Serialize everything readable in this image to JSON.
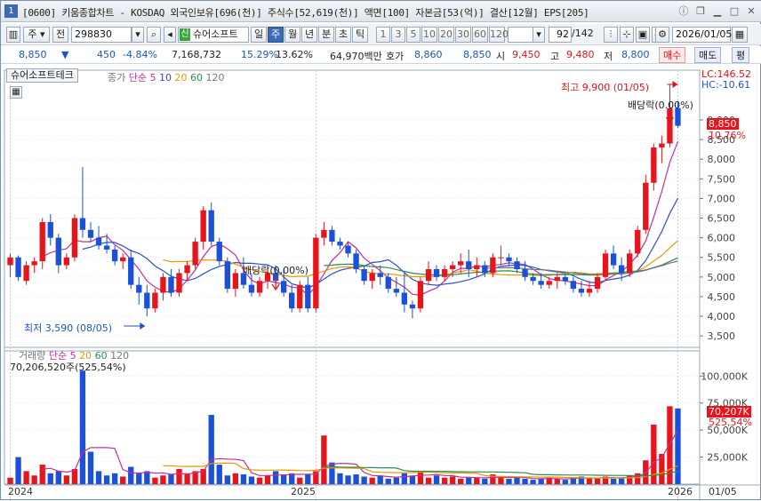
{
  "titlebar": {
    "num": "1",
    "title": "[0600] 키움종합차트 - KOSDAQ 외국인보유[696(천)] 주식수[52,619(천)] 액면[100] 자본금[53(억)] 결산[12월] EPS[205]"
  },
  "toolbar": {
    "period_select": "주",
    "prev_label": "전",
    "code": "298830",
    "name": "슈어소프트",
    "sin_label": "신",
    "periods": [
      "일",
      "주",
      "월",
      "년",
      "분",
      "초",
      "틱"
    ],
    "active_period": "주",
    "intervals": [
      "1",
      "3",
      "5",
      "10",
      "20",
      "30",
      "60",
      "120"
    ],
    "count": "92",
    "total": "/142",
    "date": "2026/01/05"
  },
  "quote": {
    "price": "8,850",
    "change": "450",
    "change_pct": "-4.84%",
    "volume": "7,168,732",
    "ratio1": "15.29%",
    "ratio2": "13.62%",
    "amount": "64,970백만",
    "ask_label": "호가",
    "ask1": "8,860",
    "ask2": "8,850",
    "open_label": "시",
    "open": "9,450",
    "high_label": "고",
    "high": "9,480",
    "low_label": "저",
    "low": "8,800",
    "buy_label": "매수",
    "sell_label": "매도",
    "avg_label": "평"
  },
  "chart": {
    "tab_name": "슈어소프트테크",
    "price_legend": {
      "title": "종가",
      "kind": "단순",
      "ma": [
        "5",
        "10",
        "20",
        "60",
        "120"
      ]
    },
    "vol_legend": {
      "title": "거래량",
      "kind": "단순",
      "ma": [
        "5",
        "20",
        "60",
        "120"
      ]
    },
    "vol_value": "70,206,520주(525,54%)",
    "lc": "LC:146.52",
    "hc": "HC:-10.61",
    "high_note": "최고 9,900 (01/05)",
    "low_note": "최저 3,590 (08/05)",
    "div1": "배당락(0.00%)",
    "div2": "배당락(0,00%)",
    "last_price_tag": "8,850",
    "last_pct_tag": "10,76%",
    "vol_tag": "70,207K",
    "vol_pct_tag": "525,54%",
    "x_labels": [
      "2024",
      "2025",
      "2026",
      "01/05"
    ],
    "colors": {
      "up": "#e8141c",
      "down": "#1b50d8",
      "ma5": "#c22f9a",
      "ma10": "#2a4fcf",
      "ma20": "#e59a00",
      "ma60": "#2e8b57",
      "ma120": "#777777"
    }
  },
  "chart_data": [
    {
      "type": "candlestick",
      "y_ticks": [
        "9,000",
        "8,500",
        "8,000",
        "7,500",
        "7,000",
        "6,500",
        "6,000",
        "5,500",
        "5,000",
        "4,500",
        "4,000",
        "3,500"
      ],
      "ylim": [
        3300,
        9950
      ],
      "candles": [
        [
          5300,
          5600,
          5000,
          5500
        ],
        [
          5500,
          5550,
          4900,
          5000
        ],
        [
          4900,
          5400,
          4800,
          5300
        ],
        [
          5300,
          5500,
          5100,
          5400
        ],
        [
          5400,
          6500,
          5200,
          6400
        ],
        [
          6400,
          6600,
          5800,
          6000
        ],
        [
          6000,
          6100,
          5100,
          5300
        ],
        [
          5300,
          5600,
          5200,
          5500
        ],
        [
          5500,
          6600,
          5400,
          6500
        ],
        [
          6500,
          7800,
          6000,
          6200
        ],
        [
          6200,
          6400,
          5900,
          6000
        ],
        [
          6000,
          6300,
          5700,
          5800
        ],
        [
          5800,
          6100,
          5600,
          5700
        ],
        [
          5700,
          5800,
          5300,
          5400
        ],
        [
          5400,
          5600,
          5200,
          5500
        ],
        [
          5500,
          5700,
          4700,
          4800
        ],
        [
          4800,
          5000,
          4300,
          4600
        ],
        [
          4600,
          4800,
          4000,
          4200
        ],
        [
          4200,
          4700,
          4100,
          4600
        ],
        [
          4600,
          5100,
          4400,
          5000
        ],
        [
          5000,
          5200,
          4500,
          4600
        ],
        [
          4600,
          5200,
          4500,
          5100
        ],
        [
          5100,
          5400,
          4900,
          5300
        ],
        [
          5300,
          6000,
          5200,
          5900
        ],
        [
          5900,
          6800,
          5700,
          6700
        ],
        [
          6700,
          6900,
          5800,
          5900
        ],
        [
          5900,
          6000,
          5300,
          5400
        ],
        [
          5400,
          5500,
          4600,
          4700
        ],
        [
          4700,
          5200,
          4500,
          5100
        ],
        [
          5100,
          5500,
          4700,
          4800
        ],
        [
          4800,
          5100,
          4500,
          4600
        ],
        [
          4600,
          5000,
          4500,
          4900
        ],
        [
          4900,
          5300,
          4700,
          5100
        ],
        [
          5100,
          5300,
          4800,
          4900
        ],
        [
          4900,
          5200,
          4500,
          4600
        ],
        [
          4600,
          4800,
          4100,
          4200
        ],
        [
          4200,
          4900,
          4100,
          4800
        ],
        [
          4800,
          5000,
          4100,
          4200
        ],
        [
          4200,
          6100,
          4100,
          6000
        ],
        [
          6000,
          6400,
          5800,
          6200
        ],
        [
          6200,
          6300,
          5800,
          5900
        ],
        [
          5900,
          6000,
          5700,
          5800
        ],
        [
          5800,
          5900,
          5500,
          5600
        ],
        [
          5600,
          5700,
          5100,
          5200
        ],
        [
          5200,
          5300,
          4800,
          4900
        ],
        [
          4900,
          5200,
          4700,
          5100
        ],
        [
          5100,
          5300,
          4800,
          5000
        ],
        [
          5000,
          5100,
          4600,
          4700
        ],
        [
          4700,
          5000,
          4500,
          4600
        ],
        [
          4600,
          5100,
          4100,
          4300
        ],
        [
          4300,
          4400,
          3950,
          4200
        ],
        [
          4200,
          5000,
          4100,
          4900
        ],
        [
          4900,
          5400,
          4800,
          5200
        ],
        [
          5200,
          5300,
          4900,
          5000
        ],
        [
          5000,
          5300,
          4900,
          5200
        ],
        [
          5200,
          5400,
          5000,
          5300
        ],
        [
          5300,
          5600,
          5100,
          5400
        ],
        [
          5400,
          5700,
          5000,
          5200
        ],
        [
          5200,
          5500,
          5000,
          5300
        ],
        [
          5300,
          5400,
          5000,
          5100
        ],
        [
          5100,
          5600,
          5000,
          5500
        ],
        [
          5500,
          5800,
          5300,
          5500
        ],
        [
          5500,
          5600,
          5300,
          5400
        ],
        [
          5400,
          5500,
          5100,
          5200
        ],
        [
          5200,
          5400,
          4900,
          5000
        ],
        [
          5000,
          5100,
          4800,
          4900
        ],
        [
          4900,
          5100,
          4700,
          4800
        ],
        [
          4800,
          5000,
          4700,
          4900
        ],
        [
          4900,
          5100,
          4700,
          5000
        ],
        [
          5000,
          5100,
          4800,
          4900
        ],
        [
          4900,
          5000,
          4600,
          4700
        ],
        [
          4700,
          4900,
          4500,
          4600
        ],
        [
          4600,
          4900,
          4500,
          4700
        ],
        [
          4700,
          5100,
          4600,
          5000
        ],
        [
          5000,
          5700,
          4900,
          5600
        ],
        [
          5600,
          5800,
          5200,
          5300
        ],
        [
          5300,
          5500,
          4900,
          5100
        ],
        [
          5100,
          5700,
          5000,
          5600
        ],
        [
          5600,
          6300,
          5500,
          6200
        ],
        [
          6200,
          7600,
          6100,
          7400
        ],
        [
          7400,
          8400,
          7200,
          8300
        ],
        [
          8300,
          8600,
          7900,
          8400
        ],
        [
          8400,
          9900,
          8300,
          9300
        ],
        [
          9300,
          9480,
          8800,
          8850
        ]
      ]
    },
    {
      "type": "bar",
      "name": "거래량",
      "y_ticks": [
        "100,000K",
        "75,000K",
        "50,000K",
        "25,000K"
      ],
      "ylim": [
        0,
        115000
      ],
      "values": [
        6,
        25,
        12,
        8,
        18,
        10,
        12,
        8,
        14,
        105,
        30,
        12,
        8,
        10,
        7,
        16,
        10,
        12,
        6,
        8,
        9,
        14,
        10,
        12,
        14,
        64,
        18,
        8,
        10,
        9,
        7,
        6,
        8,
        12,
        9,
        10,
        6,
        9,
        12,
        45,
        20,
        10,
        8,
        9,
        7,
        6,
        8,
        5,
        6,
        10,
        8,
        12,
        6,
        8,
        6,
        7,
        5,
        6,
        6,
        5,
        9,
        6,
        5,
        6,
        5,
        4,
        5,
        6,
        5,
        4,
        6,
        7,
        5,
        6,
        7,
        5,
        6,
        8,
        10,
        22,
        55,
        28,
        72,
        70
      ]
    }
  ]
}
